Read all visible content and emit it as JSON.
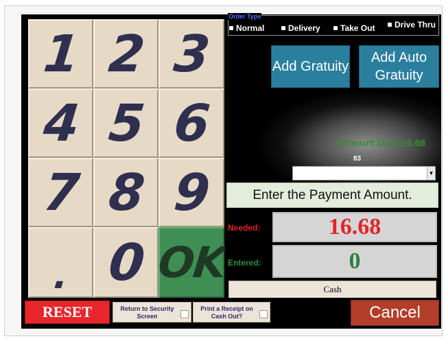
{
  "keypad": {
    "k1": "1",
    "k2": "2",
    "k3": "3",
    "k4": "4",
    "k5": "5",
    "k6": "6",
    "k7": "7",
    "k8": "8",
    "k9": "9",
    "kdot": ".",
    "k0": "0",
    "kok": "OK"
  },
  "order_type": {
    "title": "Order Type",
    "options": [
      "Normal",
      "Delivery",
      "Take Out",
      "Drive Thru"
    ]
  },
  "gratuity": {
    "add_label": "Add Gratuity",
    "add_auto_label": "Add Auto Gratuity"
  },
  "amount_due": "Amount Due: 16.68",
  "selector_number": "83",
  "prompt": "Enter the Payment Amount.",
  "needed": {
    "label": "Needed:",
    "value": "16.68",
    "color": "#e0262a"
  },
  "entered": {
    "label": "Entered:",
    "value": "0",
    "color": "#2f7f3f"
  },
  "payment_method": "Cash",
  "bottom": {
    "reset_label": "RESET",
    "return_security_label": "Return to Security Screen",
    "print_receipt_label": "Print a Receipt on Cash Out?",
    "cancel_label": "Cancel"
  },
  "colors": {
    "ok_key": "#3f8f55",
    "gratuity_button": "#2b7f9e",
    "reset": "#e8262b",
    "cancel": "#b33e2a"
  }
}
